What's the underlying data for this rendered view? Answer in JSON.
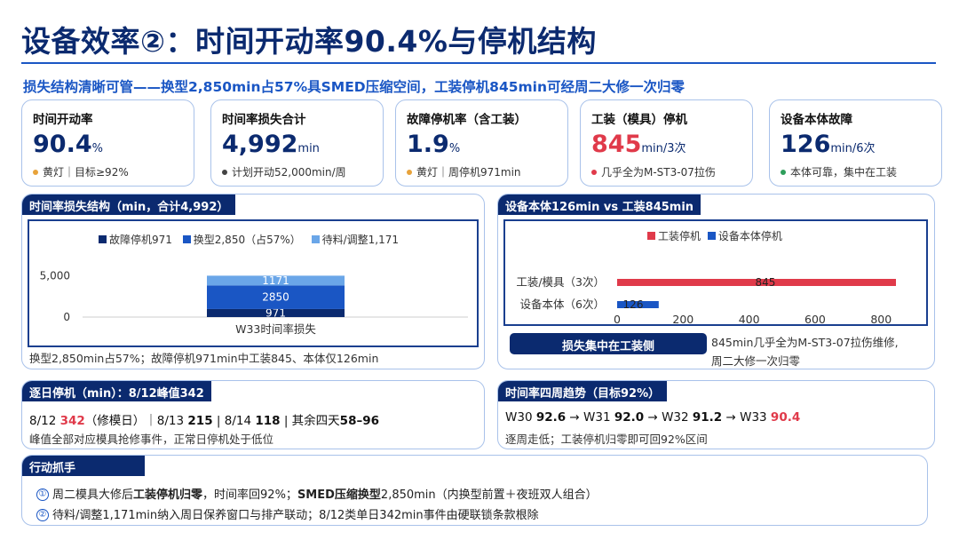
{
  "header": {
    "title": "设备效率②：时间开动率90.4%与停机结构",
    "subtitle": "损失结构清晰可管——换型2,850min占57%具SMED压缩空间，工装停机845min可经周二大修一次归零"
  },
  "kpis": [
    {
      "label": "时间开动率",
      "value": "90.4",
      "unit": "%",
      "note": "黄灯｜目标≥92%",
      "dot_color": "#e8a33a",
      "value_color": "#0b2a6f"
    },
    {
      "label": "时间率损失合计",
      "value": "4,992",
      "unit": "min",
      "note": "计划开动52,000min/周",
      "dot_color": "#444444",
      "value_color": "#0b2a6f"
    },
    {
      "label": "故障停机率（含工装）",
      "value": "1.9",
      "unit": "%",
      "note": "黄灯｜周停机971min",
      "dot_color": "#e8a33a",
      "value_color": "#0b2a6f"
    },
    {
      "label": "工装（模具）停机",
      "value": "845",
      "unit": "min/3次",
      "note": "几乎全为M-ST3-07拉伤",
      "dot_color": "#e03a4a",
      "value_color": "#e03a4a"
    },
    {
      "label": "设备本体故障",
      "value": "126",
      "unit": "min/6次",
      "note": "本体可靠，集中在工装",
      "dot_color": "#2e9e5b",
      "value_color": "#0b2a6f"
    }
  ],
  "loss_panel": {
    "head": "时间率损失结构（min，合计4,992）",
    "caption": "换型2,850min占57%；故障停机971min中工装845、本体仅126min"
  },
  "compare_panel": {
    "head": "设备本体126min vs 工装845min",
    "button": "损失集中在工装侧",
    "note_line1": "845min几乎全为M-ST3-07拉伤维修,",
    "note_line2": "周二大修一次归零"
  },
  "daily_panel": {
    "head": "逐日停机（min）：8/12峰值342",
    "seg1": "8/12 ",
    "peak": "342",
    "seg2": "（修模日）｜8/13 ",
    "v813": "215",
    "seg3": " | 8/14 ",
    "v814": "118",
    "seg4": " | 其余四天",
    "rest": "58–96",
    "line2": "峰值全部对应模具抢修事件，正常日停机处于低位"
  },
  "trend_panel": {
    "head": "时间率四周趋势（目标92%）",
    "w30_label": "W30 ",
    "w30": "92.6",
    "w31_label": " → W31 ",
    "w31": "92.0",
    "w32_label": " → W32 ",
    "w32": "91.2",
    "w33_label": " → W33 ",
    "w33": "90.4",
    "line2": "逐周走低；工装停机归零即可回92%区间"
  },
  "actions": {
    "head": "行动抓手",
    "n1": "①",
    "a1_pre": "周二模具大修后",
    "a1_b1": "工装停机归零",
    "a1_mid": "，时间率回92%；",
    "a1_b2": "SMED压缩换型",
    "a1_post": "2,850min（内换型前置＋夜班双人组合）",
    "n2": "②",
    "a2": "待料/调整1,171min纳入周日保养窗口与排产联动；8/12类单日342min事件由硬联锁条款根除"
  },
  "chart_data": [
    {
      "type": "bar",
      "stacked": true,
      "categories": [
        "W33时间率损失"
      ],
      "series": [
        {
          "name": "故障停机971",
          "values": [
            971
          ],
          "color": "#0b2a6f"
        },
        {
          "name": "换型2,850（占57%）",
          "values": [
            2850
          ],
          "color": "#1a56c4"
        },
        {
          "name": "待料/调整1,171",
          "values": [
            1171
          ],
          "color": "#6aa6e8"
        }
      ],
      "yticks": [
        0,
        5000
      ],
      "ytick_labels": [
        "0",
        "5,000"
      ],
      "ylim": [
        0,
        6000
      ],
      "legend": "top"
    },
    {
      "type": "bar",
      "orientation": "horizontal",
      "categories": [
        "工装/模具（3次）",
        "设备本体（6次）"
      ],
      "series": [
        {
          "name": "工装停机",
          "values": [
            845,
            null
          ],
          "color": "#e03a4a"
        },
        {
          "name": "设备本体停机",
          "values": [
            null,
            126
          ],
          "color": "#1a56c4"
        }
      ],
      "xticks": [
        0,
        200,
        400,
        600,
        800
      ],
      "xlim": [
        0,
        880
      ],
      "legend": "top"
    }
  ]
}
